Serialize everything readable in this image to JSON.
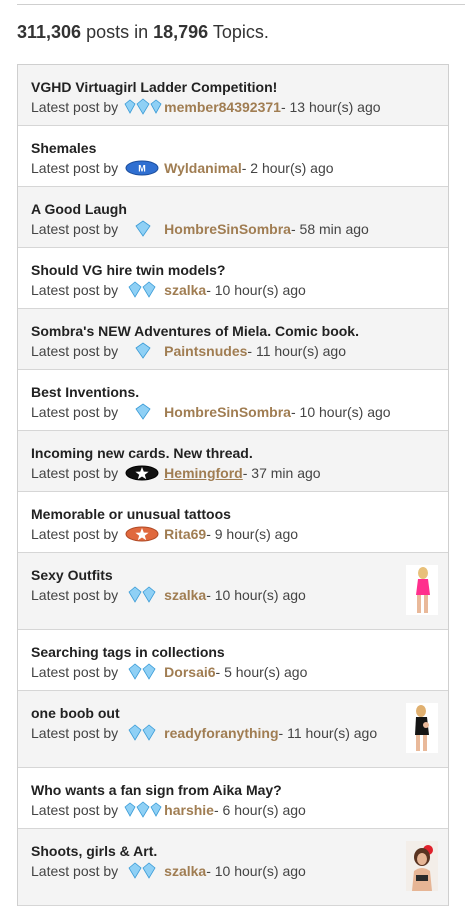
{
  "stats": {
    "posts_count": "311,306",
    "posts_word": " posts in ",
    "topics_count": "18,796",
    "topics_word": " Topics."
  },
  "latest_post_label": "Latest post by",
  "topics": [
    {
      "title": "VGHD Virtuagirl Ladder Competition!",
      "author": "member84392371",
      "time": " - 13 hour(s) ago",
      "badge": "triple-diamond-icon"
    },
    {
      "title": "Shemales",
      "author": "Wyldanimal",
      "time": " - 2 hour(s) ago",
      "badge": "blue-oval-badge-icon"
    },
    {
      "title": "A Good Laugh",
      "author": "HombreSinSombra",
      "time": " - 58 min ago",
      "badge": "diamond-icon"
    },
    {
      "title": "Should VG hire twin models?",
      "author": "szalka",
      "time": " - 10 hour(s) ago",
      "badge": "double-diamond-icon"
    },
    {
      "title": "Sombra's NEW Adventures of Miela. Comic book.",
      "author": "Paintsnudes",
      "time": " - 11 hour(s) ago",
      "badge": "diamond-icon"
    },
    {
      "title": "Best Inventions.",
      "author": "HombreSinSombra",
      "time": " - 10 hour(s) ago",
      "badge": "diamond-icon"
    },
    {
      "title": "Incoming new cards. New thread.",
      "author": "Hemingford",
      "time": " - 37 min ago",
      "badge": "black-star-badge-icon"
    },
    {
      "title": "Memorable or unusual tattoos",
      "author": "Rita69",
      "time": " - 9 hour(s) ago",
      "badge": "orange-star-badge-icon"
    },
    {
      "title": "Sexy Outfits",
      "author": "szalka",
      "time": " - 10 hour(s) ago",
      "badge": "double-diamond-icon"
    },
    {
      "title": "Searching tags in collections",
      "author": "Dorsai6",
      "time": " - 5 hour(s) ago",
      "badge": "double-diamond-icon"
    },
    {
      "title": "one boob out",
      "author": "readyforanything",
      "time": " - 11 hour(s) ago",
      "badge": "double-diamond-icon"
    },
    {
      "title": "Who wants a fan sign from Aika May?",
      "author": "harshie",
      "time": " - 6 hour(s) ago",
      "badge": "triple-diamond-icon"
    },
    {
      "title": "Shoots, girls & Art.",
      "author": "szalka",
      "time": " - 10 hour(s) ago",
      "badge": "double-diamond-icon"
    }
  ],
  "colors": {
    "author": "#a07d52",
    "row_alt": "#f4f4f4",
    "border": "#d6d6d6",
    "diamond": "#7cc4ee"
  }
}
